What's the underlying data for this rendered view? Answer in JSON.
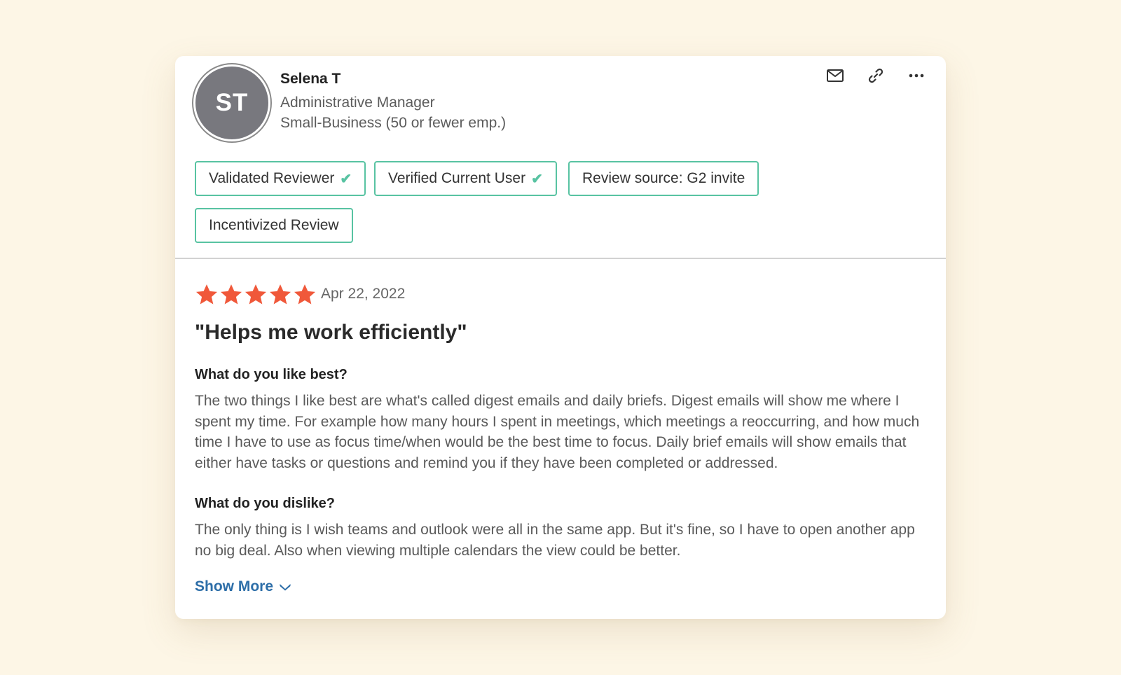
{
  "reviewer": {
    "initials": "ST",
    "name": "Selena T",
    "role": "Administrative Manager",
    "segment": "Small-Business (50 or fewer emp.)"
  },
  "actions": [
    {
      "icon": "mail-icon"
    },
    {
      "icon": "link-icon"
    },
    {
      "icon": "more-icon"
    }
  ],
  "badges": [
    {
      "label": "Validated Reviewer",
      "checked": true
    },
    {
      "label": "Verified Current User",
      "checked": true
    },
    {
      "label": "Review source: G2 invite",
      "checked": false
    },
    {
      "label": "Incentivized Review",
      "checked": false
    }
  ],
  "check_glyph": "✔",
  "review": {
    "rating": 5,
    "max_rating": 5,
    "date": "Apr 22, 2022",
    "title": "\"Helps me work efficiently\"",
    "sections": [
      {
        "question": "What do you like best?",
        "answer": "The two things I like best are what's called digest emails and daily briefs. Digest emails will show me where I spent my time. For example how many hours I spent in meetings, which meetings a reoccurring, and how much time I have to use as focus time/when would be the best time to focus. Daily brief emails will show emails that either have tasks or questions and remind you if they have been completed or addressed."
      },
      {
        "question": "What do you dislike?",
        "answer": "The only thing is I wish teams and outlook were all in the same app. But it's fine, so I have to open another app no big deal. Also when viewing multiple calendars the view could be better."
      }
    ],
    "show_more_label": "Show More"
  },
  "colors": {
    "star": "#f0583a",
    "badge_border": "#58c3a2",
    "link": "#2d6ea8",
    "background": "#fdf6e6",
    "avatar": "#78787e"
  }
}
